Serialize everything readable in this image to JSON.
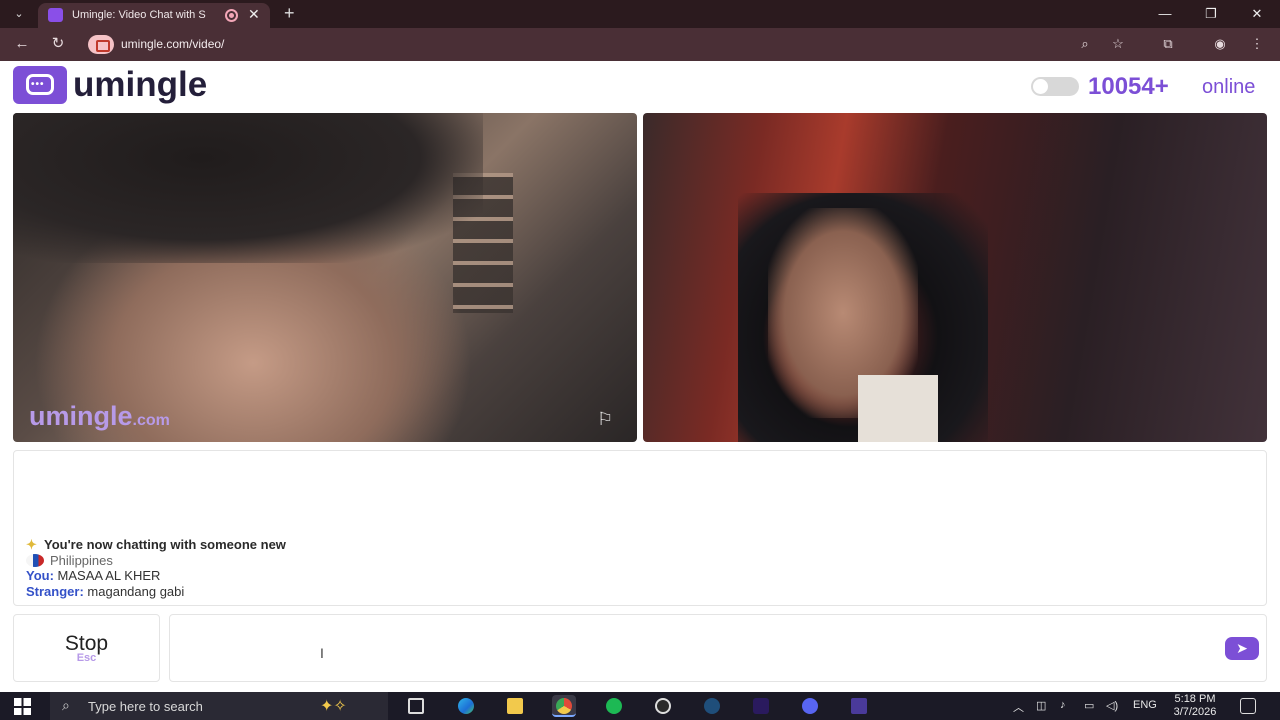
{
  "browser": {
    "tab_title": "Umingle: Video Chat with S",
    "new_tab_icon": "+",
    "close_tab_icon": "✕",
    "url": "umingle.com/video/",
    "window_controls": [
      "—",
      "❐",
      "✕"
    ]
  },
  "header": {
    "logo_text": "umingle",
    "online_count": "10054+",
    "online_label": "online"
  },
  "video": {
    "watermark": "umingle",
    "watermark_suffix": ".com"
  },
  "chat": {
    "system_message": "You're now chatting with someone new",
    "country": "Philippines",
    "messages": [
      {
        "sender": "You:",
        "text": "MASAA AL KHER"
      },
      {
        "sender": "Stranger:",
        "text": "magandang gabi"
      }
    ]
  },
  "controls": {
    "stop_label": "Stop",
    "stop_key": "Esc",
    "input_value": ""
  },
  "taskbar": {
    "search_placeholder": "Type here to search",
    "language": "ENG",
    "time": "5:18 PM",
    "date": "3/7/2026"
  },
  "colors": {
    "brand": "#7c4fd6",
    "label_blue": "#3451c8"
  }
}
